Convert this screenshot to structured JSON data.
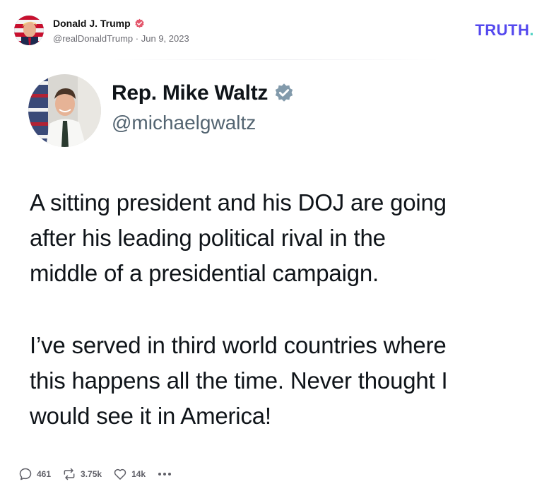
{
  "post": {
    "author_name": "Donald J. Trump",
    "handle": "@realDonaldTrump",
    "separator": "·",
    "date": "Jun 9, 2023"
  },
  "brand": {
    "logo_text": "TRUTH",
    "logo_dot": ".",
    "color": "#5448ee",
    "dot_color": "#53d3c5"
  },
  "embed": {
    "name": "Rep. Mike Waltz",
    "handle": "@michaelgwaltz",
    "paragraphs": [
      [
        "A sitting president and his DOJ are going",
        "after his leading political rival in the",
        "middle of a presidential campaign."
      ],
      [
        "I’ve served in third world countries where",
        "this happens all the time. Never thought I",
        "would see it in America!"
      ]
    ]
  },
  "actions": {
    "replies": "461",
    "retruths": "3.75k",
    "likes": "14k"
  },
  "icons": {
    "verified_main": "verified-badge-icon",
    "verified_embed": "verified-badge-icon",
    "reply": "reply-icon",
    "retruth": "retruth-icon",
    "like": "heart-icon",
    "more": "more-icon"
  }
}
